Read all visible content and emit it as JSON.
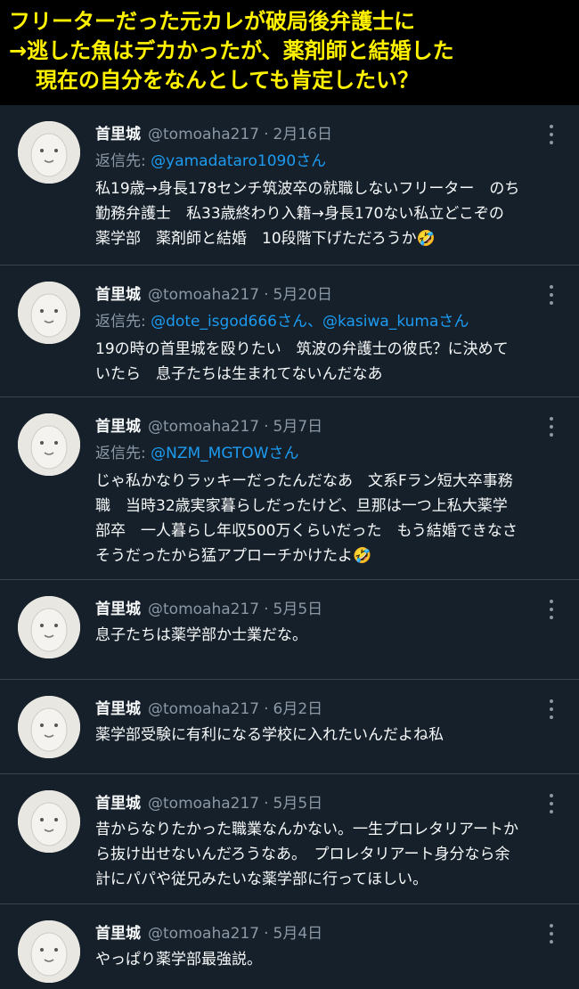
{
  "banner": {
    "line1": "フリーターだった元カレが破局後弁護士に",
    "line2": "→逃した魚はデカかったが、薬剤師と結婚した",
    "line3": "現在の自分をなんとしても肯定したい？"
  },
  "tweets": [
    {
      "name": "首里城",
      "handle": "@tomoaha217",
      "dot": "·",
      "date": "2月16日",
      "reply_prefix": "返信先: ",
      "reply_to": "@yamadataro1090さん",
      "text": "私19歳→身長178センチ筑波卒の就職しないフリーター　のち\n勤務弁護士　私33歳終わり入籍→身長170ない私立どこぞの\n薬学部　薬剤師と結婚　10段階下げただろうか🤣"
    },
    {
      "name": "首里城",
      "handle": "@tomoaha217",
      "dot": "·",
      "date": "5月20日",
      "reply_prefix": "返信先: ",
      "reply_to": "@dote_isgod666さん、@kasiwa_kumaさん",
      "text": "19の時の首里城を殴りたい　筑波の弁護士の彼氏？に決めて\nいたら　息子たちは生まれてないんだなあ"
    },
    {
      "name": "首里城",
      "handle": "@tomoaha217",
      "dot": "·",
      "date": "5月7日",
      "reply_prefix": "返信先: ",
      "reply_to": "@NZM_MGTOWさん",
      "text": "じゃ私かなりラッキーだったんだなあ　文系Fラン短大卒事務\n職　当時32歳実家暮らしだったけど、旦那は一つ上私大薬学\n部卒　一人暮らし年収500万くらいだった　もう結婚できなさ\nそうだったから猛アプローチかけたよ🤣"
    },
    {
      "name": "首里城",
      "handle": "@tomoaha217",
      "dot": "·",
      "date": "5月5日",
      "text": "息子たちは薬学部か士業だな。"
    },
    {
      "name": "首里城",
      "handle": "@tomoaha217",
      "dot": "·",
      "date": "6月2日",
      "text": "薬学部受験に有利になる学校に入れたいんだよね私"
    },
    {
      "name": "首里城",
      "handle": "@tomoaha217",
      "dot": "·",
      "date": "5月5日",
      "text": "昔からなりたかった職業なんかない。一生プロレタリアートか\nら抜け出せないんだろうなあ。　プロレタリアート身分なら余\n計にパパや従兄みたいな薬学部に行ってほしい。"
    },
    {
      "name": "首里城",
      "handle": "@tomoaha217",
      "dot": "·",
      "date": "5月4日",
      "text": "やっぱり薬学部最強説。"
    }
  ],
  "icons": {
    "avatar": "avatar-icon",
    "more": "more-options-icon"
  },
  "colors": {
    "background": "#15202b",
    "link": "#1d9bf0",
    "muted": "#8b98a5",
    "banner_text": "#fff200"
  }
}
